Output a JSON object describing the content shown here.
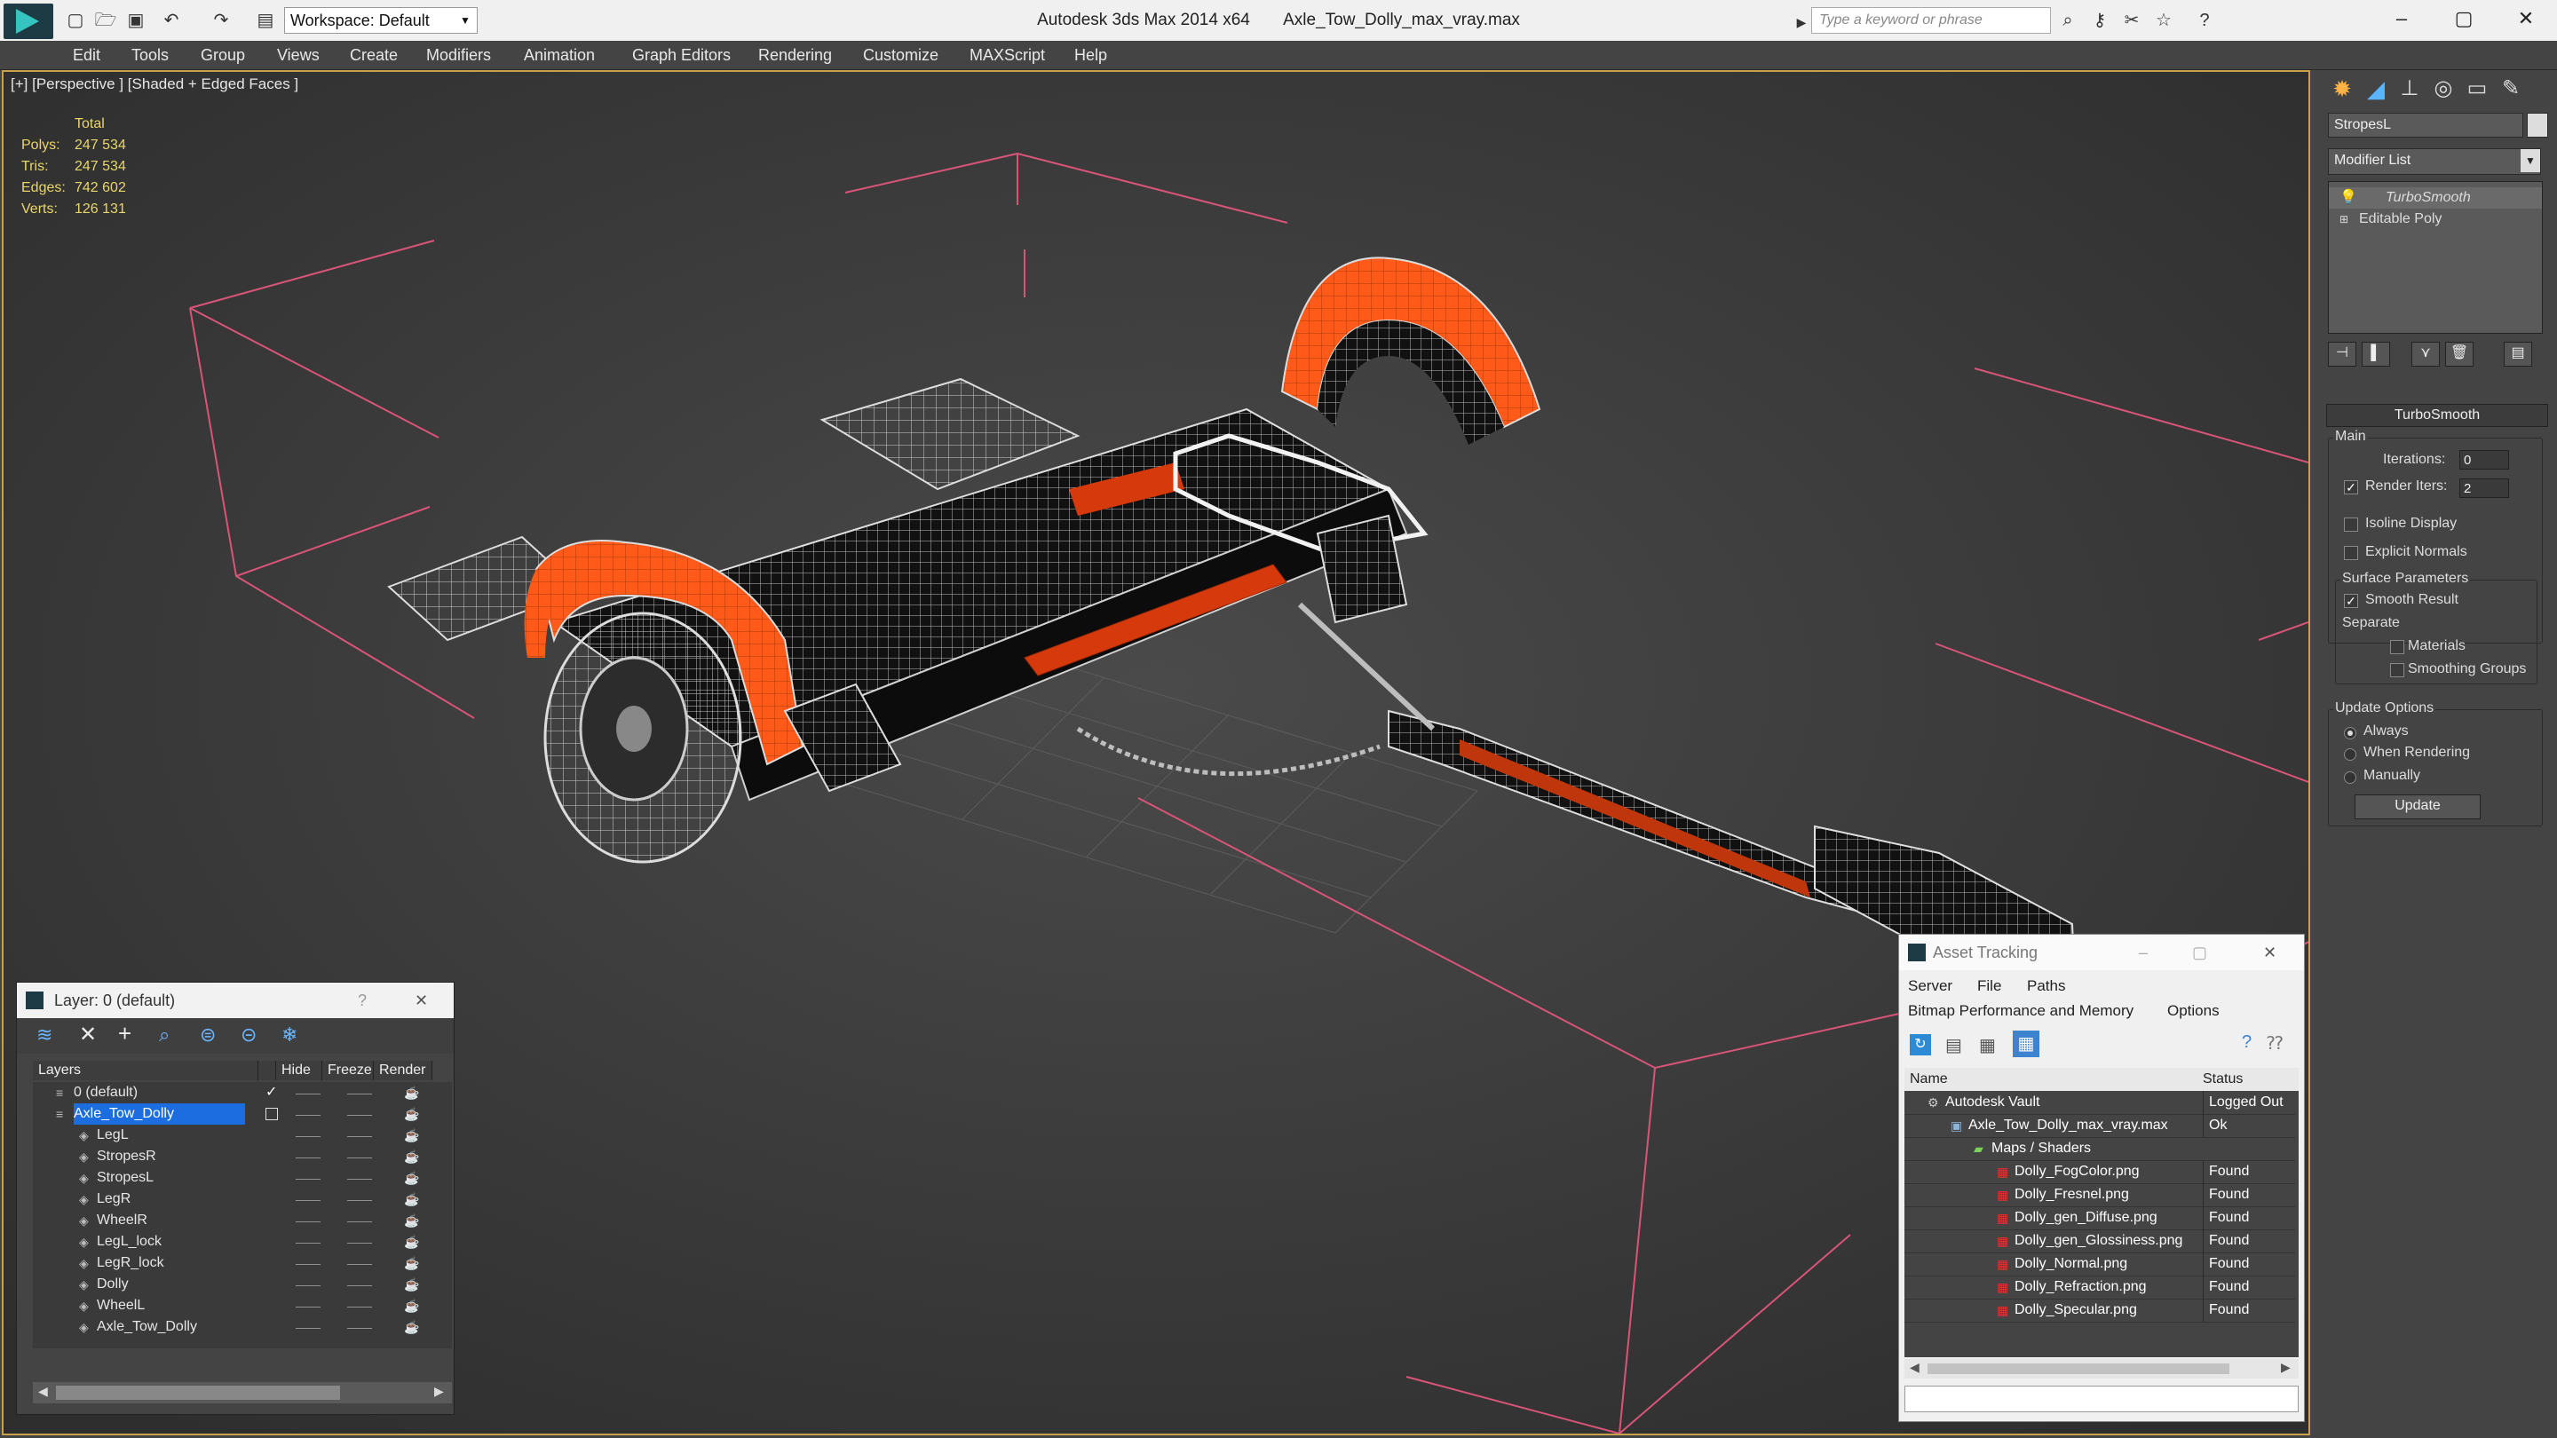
{
  "app": {
    "title": "Autodesk 3ds Max  2014 x64",
    "file": "Axle_Tow_Dolly_max_vray.max",
    "workspace": "Workspace: Default",
    "search_placeholder": "Type a keyword or phrase"
  },
  "menu": [
    "Edit",
    "Tools",
    "Group",
    "Views",
    "Create",
    "Modifiers",
    "Animation",
    "Graph Editors",
    "Rendering",
    "Customize",
    "MAXScript",
    "Help"
  ],
  "viewport": {
    "label": "[+] [Perspective ] [Shaded + Edged Faces ]",
    "stats": {
      "header": "Total",
      "rows": [
        {
          "label": "Polys:",
          "value": "247 534"
        },
        {
          "label": "Tris:",
          "value": "247 534"
        },
        {
          "label": "Edges:",
          "value": "742 602"
        },
        {
          "label": "Verts:",
          "value": "126 131"
        }
      ]
    }
  },
  "command_panel": {
    "object_name": "StropesL",
    "modifier_list": "Modifier List",
    "stack": [
      "TurboSmooth",
      "Editable Poly"
    ],
    "rollout": "TurboSmooth",
    "main_group": "Main",
    "iterations_label": "Iterations:",
    "iterations": "0",
    "render_iters_label": "Render Iters:",
    "render_iters": "2",
    "isoline": "Isoline Display",
    "explicit_normals": "Explicit Normals",
    "surface_params": "Surface Parameters",
    "smooth_result": "Smooth Result",
    "separate": "Separate",
    "materials": "Materials",
    "smoothing_groups": "Smoothing Groups",
    "update_options": "Update Options",
    "always": "Always",
    "when_rendering": "When Rendering",
    "manually": "Manually",
    "update_btn": "Update"
  },
  "layer_window": {
    "title": "Layer: 0 (default)",
    "help": "?",
    "close": "✕",
    "columns": [
      "Layers",
      "Hide",
      "Freeze",
      "Render"
    ],
    "layers": [
      {
        "name": "0 (default)",
        "level": 0
      },
      {
        "name": "Axle_Tow_Dolly",
        "level": 0
      },
      {
        "name": "LegL",
        "level": 1
      },
      {
        "name": "StropesR",
        "level": 1
      },
      {
        "name": "StropesL",
        "level": 1
      },
      {
        "name": "LegR",
        "level": 1
      },
      {
        "name": "WheelR",
        "level": 1
      },
      {
        "name": "LegL_lock",
        "level": 1
      },
      {
        "name": "LegR_lock",
        "level": 1
      },
      {
        "name": "Dolly",
        "level": 1
      },
      {
        "name": "WheelL",
        "level": 1
      },
      {
        "name": "Axle_Tow_Dolly",
        "level": 1
      }
    ]
  },
  "asset_window": {
    "title": "Asset Tracking",
    "menu": [
      "Server",
      "File",
      "Paths"
    ],
    "menu2": [
      "Bitmap Performance and Memory",
      "Options"
    ],
    "columns": [
      "Name",
      "Status"
    ],
    "rows": [
      {
        "name": "Autodesk Vault",
        "status": "Logged Out",
        "level": 0
      },
      {
        "name": "Axle_Tow_Dolly_max_vray.max",
        "status": "Ok",
        "level": 1
      },
      {
        "name": "Maps / Shaders",
        "status": "",
        "level": 2
      },
      {
        "name": "Dolly_FogColor.png",
        "status": "Found",
        "level": 3
      },
      {
        "name": "Dolly_Fresnel.png",
        "status": "Found",
        "level": 3
      },
      {
        "name": "Dolly_gen_Diffuse.png",
        "status": "Found",
        "level": 3
      },
      {
        "name": "Dolly_gen_Glossiness.png",
        "status": "Found",
        "level": 3
      },
      {
        "name": "Dolly_Normal.png",
        "status": "Found",
        "level": 3
      },
      {
        "name": "Dolly_Refraction.png",
        "status": "Found",
        "level": 3
      },
      {
        "name": "Dolly_Specular.png",
        "status": "Found",
        "level": 3
      }
    ]
  },
  "colors": {
    "accent_orange": "#ff5a1a",
    "selection_blue": "#1c6ee0",
    "stats_yellow": "#e9d66b",
    "viewport_border": "#c8a14a"
  }
}
